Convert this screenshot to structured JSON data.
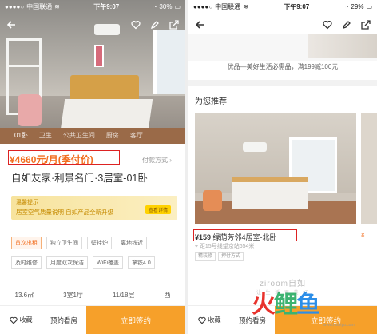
{
  "left": {
    "status": {
      "carrier": "中国联通",
      "time": "下午9:07",
      "battery": "30%"
    },
    "tabs": [
      "01卧",
      "卫生",
      "公共卫生间",
      "厨房",
      "客厅"
    ],
    "price": "¥4660元/月(季付价)",
    "pay_method": "付款方式",
    "title": "自如友家·利景名门·3居室-01卧",
    "banner": {
      "tag": "温馨提示",
      "text": "居室空气质量说明  自如产品全新升级",
      "button": "查看详情"
    },
    "tags_row1": [
      "首次出租",
      "独立卫生间",
      "壁挂炉",
      "离地铁近"
    ],
    "tags_row2": [
      "及时维修",
      "月度双次保洁",
      "WiFi覆盖",
      "拿铁4.0"
    ],
    "specs": [
      "13.6㎡",
      "3室1厅",
      "11/18层",
      "西"
    ],
    "bottom": {
      "favorite": "收藏",
      "visit": "预约看房",
      "sign": "立即签约"
    }
  },
  "right": {
    "status": {
      "carrier": "中国联通",
      "time": "下午9:07",
      "battery": "29%"
    },
    "promo": "优品—美好生活必需品，满199减100元",
    "section_title": "为您推荐",
    "rec": {
      "price": "¥159",
      "title": "绿荫芳邻4居室-北卧",
      "address": "距15号线望京站654米",
      "tags": [
        "精装修",
        "押付方式"
      ]
    },
    "peek_price": "¥",
    "brand": "ziroom自如",
    "brand_sub": "让 生 活 更 美 好",
    "bottom": {
      "favorite": "收藏",
      "visit": "预约看房",
      "sign": "立即签约"
    }
  },
  "watermark": {
    "text": [
      "火",
      "鲤",
      "鱼"
    ],
    "url": "www.hooliyu.com"
  },
  "colors": {
    "accent": "#f6a02a",
    "price": "#f26f21",
    "highlight_box": "#dd2222"
  }
}
